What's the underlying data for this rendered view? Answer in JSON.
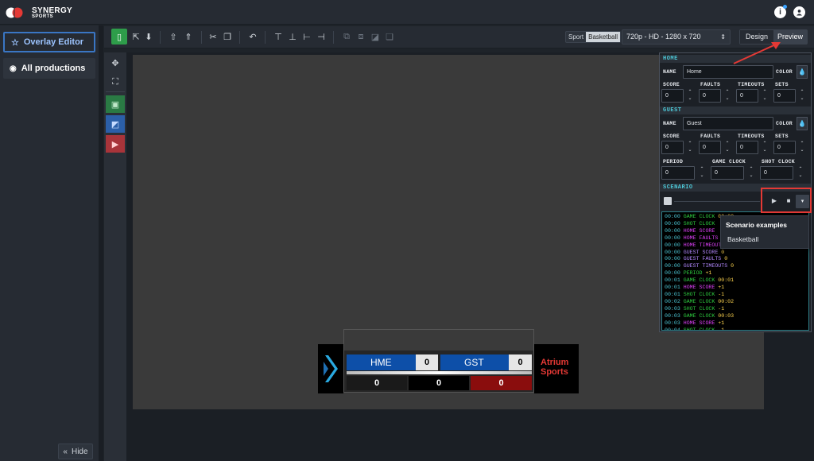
{
  "app": {
    "brand_line1": "SYNERGY",
    "brand_line2": "SPORTS"
  },
  "sidebar": {
    "items": [
      {
        "label": "Overlay Editor",
        "icon": "star-outline-icon",
        "active": true
      },
      {
        "label": "All productions",
        "icon": "camera-icon",
        "active": false
      }
    ],
    "hide_label": "Hide"
  },
  "toolbar": {
    "sport_tag": "Sport",
    "sport_value": "Basketball",
    "resolution": "720p - HD - 1280 x 720",
    "design_label": "Design",
    "preview_label": "Preview"
  },
  "panel": {
    "home_header": "HOME",
    "guest_header": "GUEST",
    "scenario_header": "SCENARIO",
    "name_label": "NAME",
    "color_label": "COLOR",
    "home_name": "Home",
    "guest_name": "Guest",
    "stat_labels": [
      "SCORE",
      "FAULTS",
      "TIMEOUTS",
      "SETS"
    ],
    "home_stats": [
      "0",
      "0",
      "0",
      "0"
    ],
    "guest_stats": [
      "0",
      "0",
      "0",
      "0"
    ],
    "clock_labels": [
      "PERIOD",
      "GAME CLOCK",
      "SHOT CLOCK"
    ],
    "clock_values": [
      "0",
      "0",
      "0"
    ]
  },
  "scenario_menu": {
    "title": "Scenario examples",
    "option": "Basketball"
  },
  "log": [
    {
      "time": "00:00",
      "field": "GAME CLOCK",
      "value": "00:00",
      "color": "#2ecc40"
    },
    {
      "time": "00:00",
      "field": "SHOT CLOCK",
      "value": "",
      "color": "#2ecc40"
    },
    {
      "time": "00:00",
      "field": "HOME SCORE",
      "value": "",
      "color": "#e040fb"
    },
    {
      "time": "00:00",
      "field": "HOME FAULTS",
      "value": "",
      "color": "#e040fb"
    },
    {
      "time": "00:00",
      "field": "HOME TIMEOUT",
      "value": "",
      "color": "#e040fb"
    },
    {
      "time": "00:00",
      "field": "GUEST SCORE",
      "value": "0",
      "color": "#b388ff"
    },
    {
      "time": "00:00",
      "field": "GUEST FAULTS",
      "value": "0",
      "color": "#b388ff"
    },
    {
      "time": "00:00",
      "field": "GUEST TIMEOUTS",
      "value": "0",
      "color": "#b388ff"
    },
    {
      "time": "00:00",
      "field": "PERIOD",
      "value": "+1",
      "color": "#2ecc40"
    },
    {
      "time": "00:01",
      "field": "GAME CLOCK",
      "value": "00:01",
      "color": "#2ecc40"
    },
    {
      "time": "00:01",
      "field": "HOME SCORE",
      "value": "+1",
      "color": "#e040fb"
    },
    {
      "time": "00:01",
      "field": "SHOT CLOCK",
      "value": "-1",
      "color": "#2ecc40"
    },
    {
      "time": "00:02",
      "field": "GAME CLOCK",
      "value": "00:02",
      "color": "#2ecc40"
    },
    {
      "time": "00:03",
      "field": "SHOT CLOCK",
      "value": "-1",
      "color": "#2ecc40"
    },
    {
      "time": "00:03",
      "field": "GAME CLOCK",
      "value": "00:03",
      "color": "#2ecc40"
    },
    {
      "time": "00:03",
      "field": "HOME SCORE",
      "value": "+1",
      "color": "#e040fb"
    },
    {
      "time": "00:04",
      "field": "SHOT CLOCK",
      "value": "-1",
      "color": "#2ecc40"
    }
  ],
  "scoreboard": {
    "home_team": "HME",
    "home_score": "0",
    "guest_team": "GST",
    "guest_score": "0",
    "bottom_values": [
      "0",
      "0",
      "0"
    ],
    "sponsor_line1": "Atrium",
    "sponsor_line2": "Sports"
  },
  "colors": {
    "accent": "#4cc7d6",
    "highlight": "#e53935",
    "home_bar": "#0d4fa8",
    "active_item": "#3a76c4"
  }
}
